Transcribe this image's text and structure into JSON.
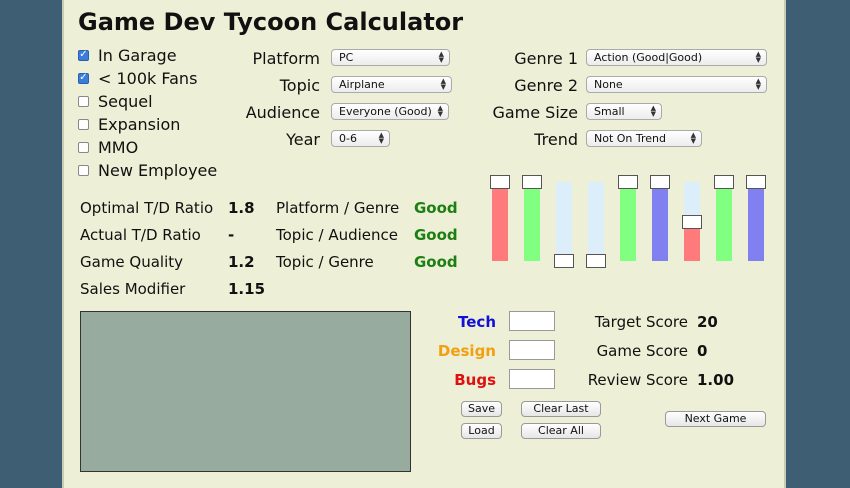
{
  "title": "Game Dev Tycoon Calculator",
  "options": [
    {
      "label": "In Garage",
      "checked": true
    },
    {
      "label": "< 100k Fans",
      "checked": true
    },
    {
      "label": "Sequel",
      "checked": false
    },
    {
      "label": "Expansion",
      "checked": false
    },
    {
      "label": "MMO",
      "checked": false
    },
    {
      "label": "New Employee",
      "checked": false
    }
  ],
  "fields": {
    "platform": {
      "label": "Platform",
      "value": "PC"
    },
    "topic": {
      "label": "Topic",
      "value": "Airplane"
    },
    "audience": {
      "label": "Audience",
      "value": "Everyone (Good)"
    },
    "year": {
      "label": "Year",
      "value": "0-6"
    },
    "genre1": {
      "label": "Genre 1",
      "value": "Action (Good|Good)"
    },
    "genre2": {
      "label": "Genre 2",
      "value": "None"
    },
    "game_size": {
      "label": "Game Size",
      "value": "Small"
    },
    "trend": {
      "label": "Trend",
      "value": "Not On Trend"
    }
  },
  "stats": [
    {
      "label": "Optimal T/D Ratio",
      "value": "1.8"
    },
    {
      "label": "Actual T/D Ratio",
      "value": "-"
    },
    {
      "label": "Game Quality",
      "value": "1.2"
    },
    {
      "label": "Sales Modifier",
      "value": "1.15"
    }
  ],
  "combos": [
    {
      "label": "Platform / Genre",
      "value": "Good"
    },
    {
      "label": "Topic / Audience",
      "value": "Good"
    },
    {
      "label": "Topic / Genre",
      "value": "Good"
    }
  ],
  "sliders": [
    {
      "color": "#ff7a7a",
      "level": 1.0
    },
    {
      "color": "#80ff80",
      "level": 1.0
    },
    {
      "color": "#dbeefa",
      "level": 0.0
    },
    {
      "color": "#dbeefa",
      "level": 0.0
    },
    {
      "color": "#80ff80",
      "level": 1.0
    },
    {
      "color": "#8080f0",
      "level": 1.0
    },
    {
      "color": "#ff7a7a",
      "level": 0.5
    },
    {
      "color": "#80ff80",
      "level": 1.0
    },
    {
      "color": "#8080f0",
      "level": 1.0
    }
  ],
  "inputs": {
    "tech": {
      "label": "Tech",
      "color": "#1010d8",
      "value": ""
    },
    "design": {
      "label": "Design",
      "color": "#f0a010",
      "value": ""
    },
    "bugs": {
      "label": "Bugs",
      "color": "#e01010",
      "value": ""
    }
  },
  "scores": {
    "target": {
      "label": "Target Score",
      "value": "20"
    },
    "game": {
      "label": "Game Score",
      "value": "0"
    },
    "review": {
      "label": "Review Score",
      "value": "1.00"
    }
  },
  "buttons": {
    "save": "Save",
    "load": "Load",
    "clear_last": "Clear Last",
    "clear_all": "Clear All",
    "next_game": "Next Game"
  }
}
